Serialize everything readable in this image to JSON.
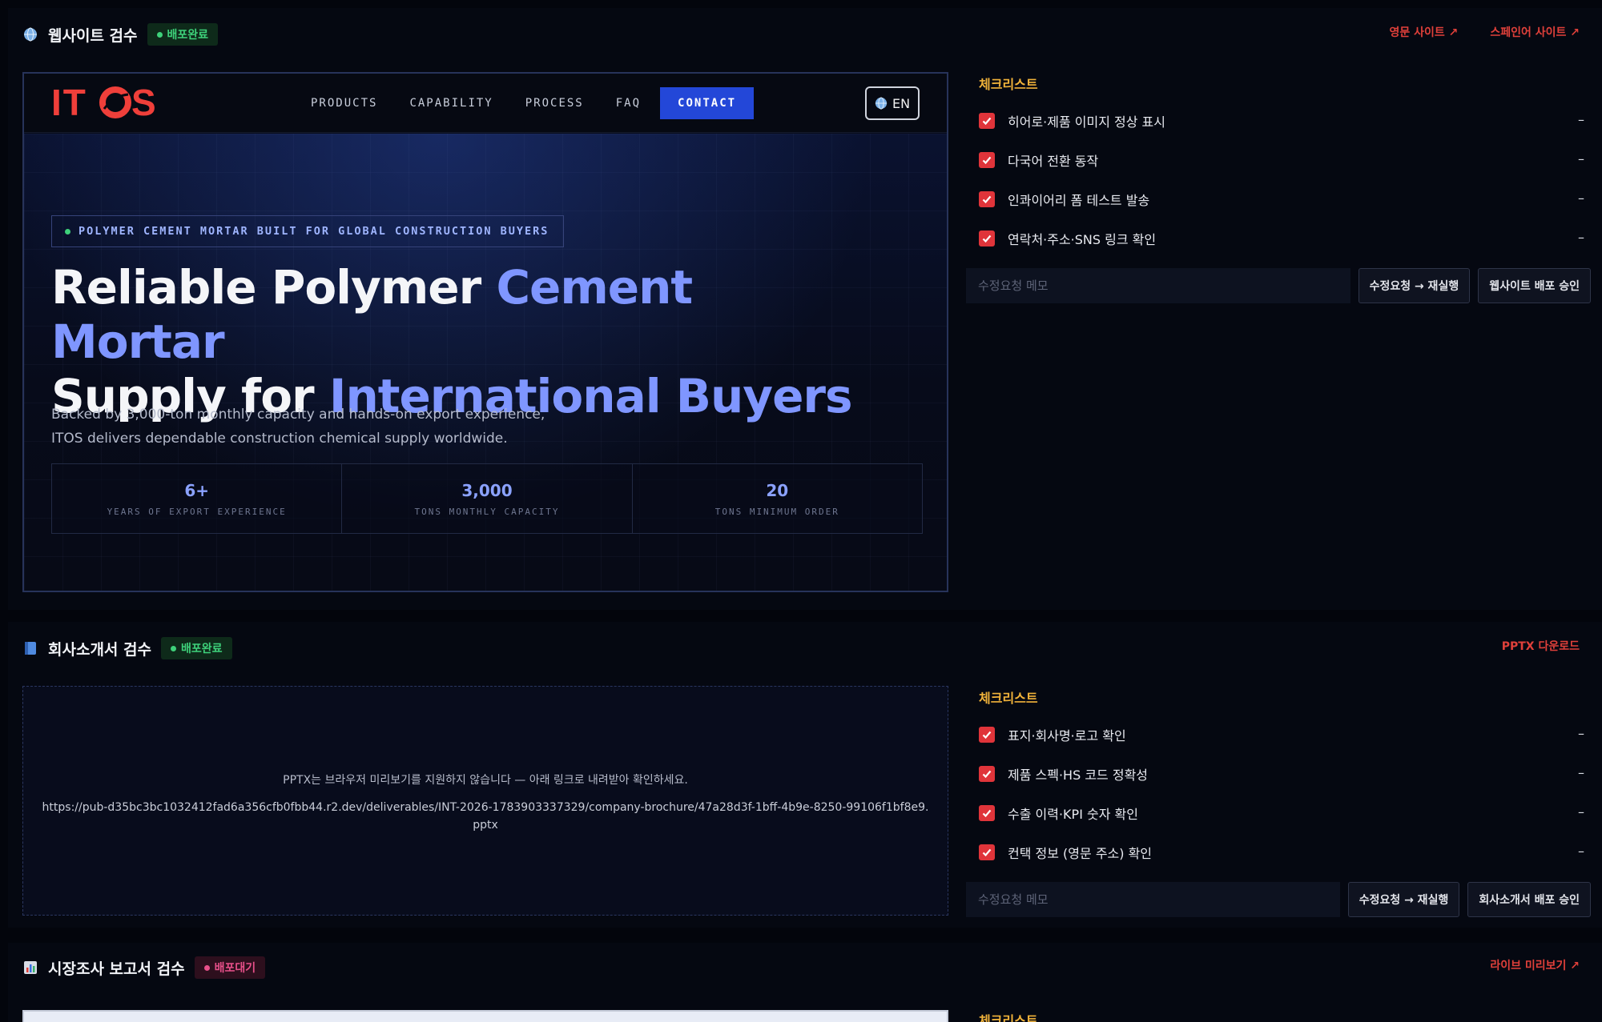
{
  "website": {
    "title": "웹사이트 검수",
    "status": "배포완료",
    "links": [
      "영문 사이트 ↗",
      "스페인어 사이트 ↗"
    ],
    "preview": {
      "logo": "ITOS",
      "nav": [
        "PRODUCTS",
        "CAPABILITY",
        "PROCESS",
        "FAQ"
      ],
      "contact": "CONTACT",
      "lang": "EN",
      "eyebrow": "POLYMER CEMENT MORTAR BUILT FOR GLOBAL CONSTRUCTION BUYERS",
      "title_part1": "Reliable Polymer ",
      "title_hl1": "Cement Mortar",
      "title_part2": "Supply for ",
      "title_hl2": "International Buyers",
      "sub_line1": "Backed by 3,000-ton monthly capacity and hands-on export experience,",
      "sub_line2": "ITOS delivers dependable construction chemical supply worldwide.",
      "stats": [
        {
          "num": "6+",
          "label": "YEARS OF EXPORT EXPERIENCE"
        },
        {
          "num": "3,000",
          "label": "TONS MONTHLY CAPACITY"
        },
        {
          "num": "20",
          "label": "TONS MINIMUM ORDER"
        }
      ]
    },
    "checklist": {
      "title": "체크리스트",
      "items": [
        "히어로·제품 이미지 정상 표시",
        "다국어 전환 동작",
        "인콰이어리 폼 테스트 발송",
        "연락처·주소·SNS 링크 확인"
      ],
      "dash": "–",
      "memo_placeholder": "수정요청 메모",
      "rerun": "수정요청 → 재실행",
      "approve": "웹사이트 배포 승인"
    }
  },
  "brochure": {
    "title": "회사소개서 검수",
    "status": "배포완료",
    "link": "PPTX 다운로드",
    "message": "PPTX는 브라우저 미리보기를 지원하지 않습니다 — 아래 링크로 내려받아 확인하세요.",
    "url": "https://pub-d35bc3bc1032412fad6a356cfb0fbb44.r2.dev/deliverables/INT-2026-1783903337329/company-brochure/47a28d3f-1bff-4b9e-8250-99106f1bf8e9.pptx",
    "checklist": {
      "title": "체크리스트",
      "items": [
        "표지·회사명·로고 확인",
        "제품 스펙·HS 코드 정확성",
        "수출 이력·KPI 숫자 확인",
        "컨택 정보 (영문 주소) 확인"
      ],
      "dash": "–",
      "memo_placeholder": "수정요청 메모",
      "rerun": "수정요청 → 재실행",
      "approve": "회사소개서 배포 승인"
    }
  },
  "report": {
    "title": "시장조사 보고서 검수",
    "status": "배포대기",
    "link": "라이브 미리보기 ↗",
    "checklist_title": "체크리스트"
  },
  "colors": {
    "accent": "#2347d8",
    "link": "#e0403a",
    "check": "#e0343a",
    "checklist_title": "#f0b23a",
    "done": "#3ed17a",
    "wait": "#e8508a"
  }
}
